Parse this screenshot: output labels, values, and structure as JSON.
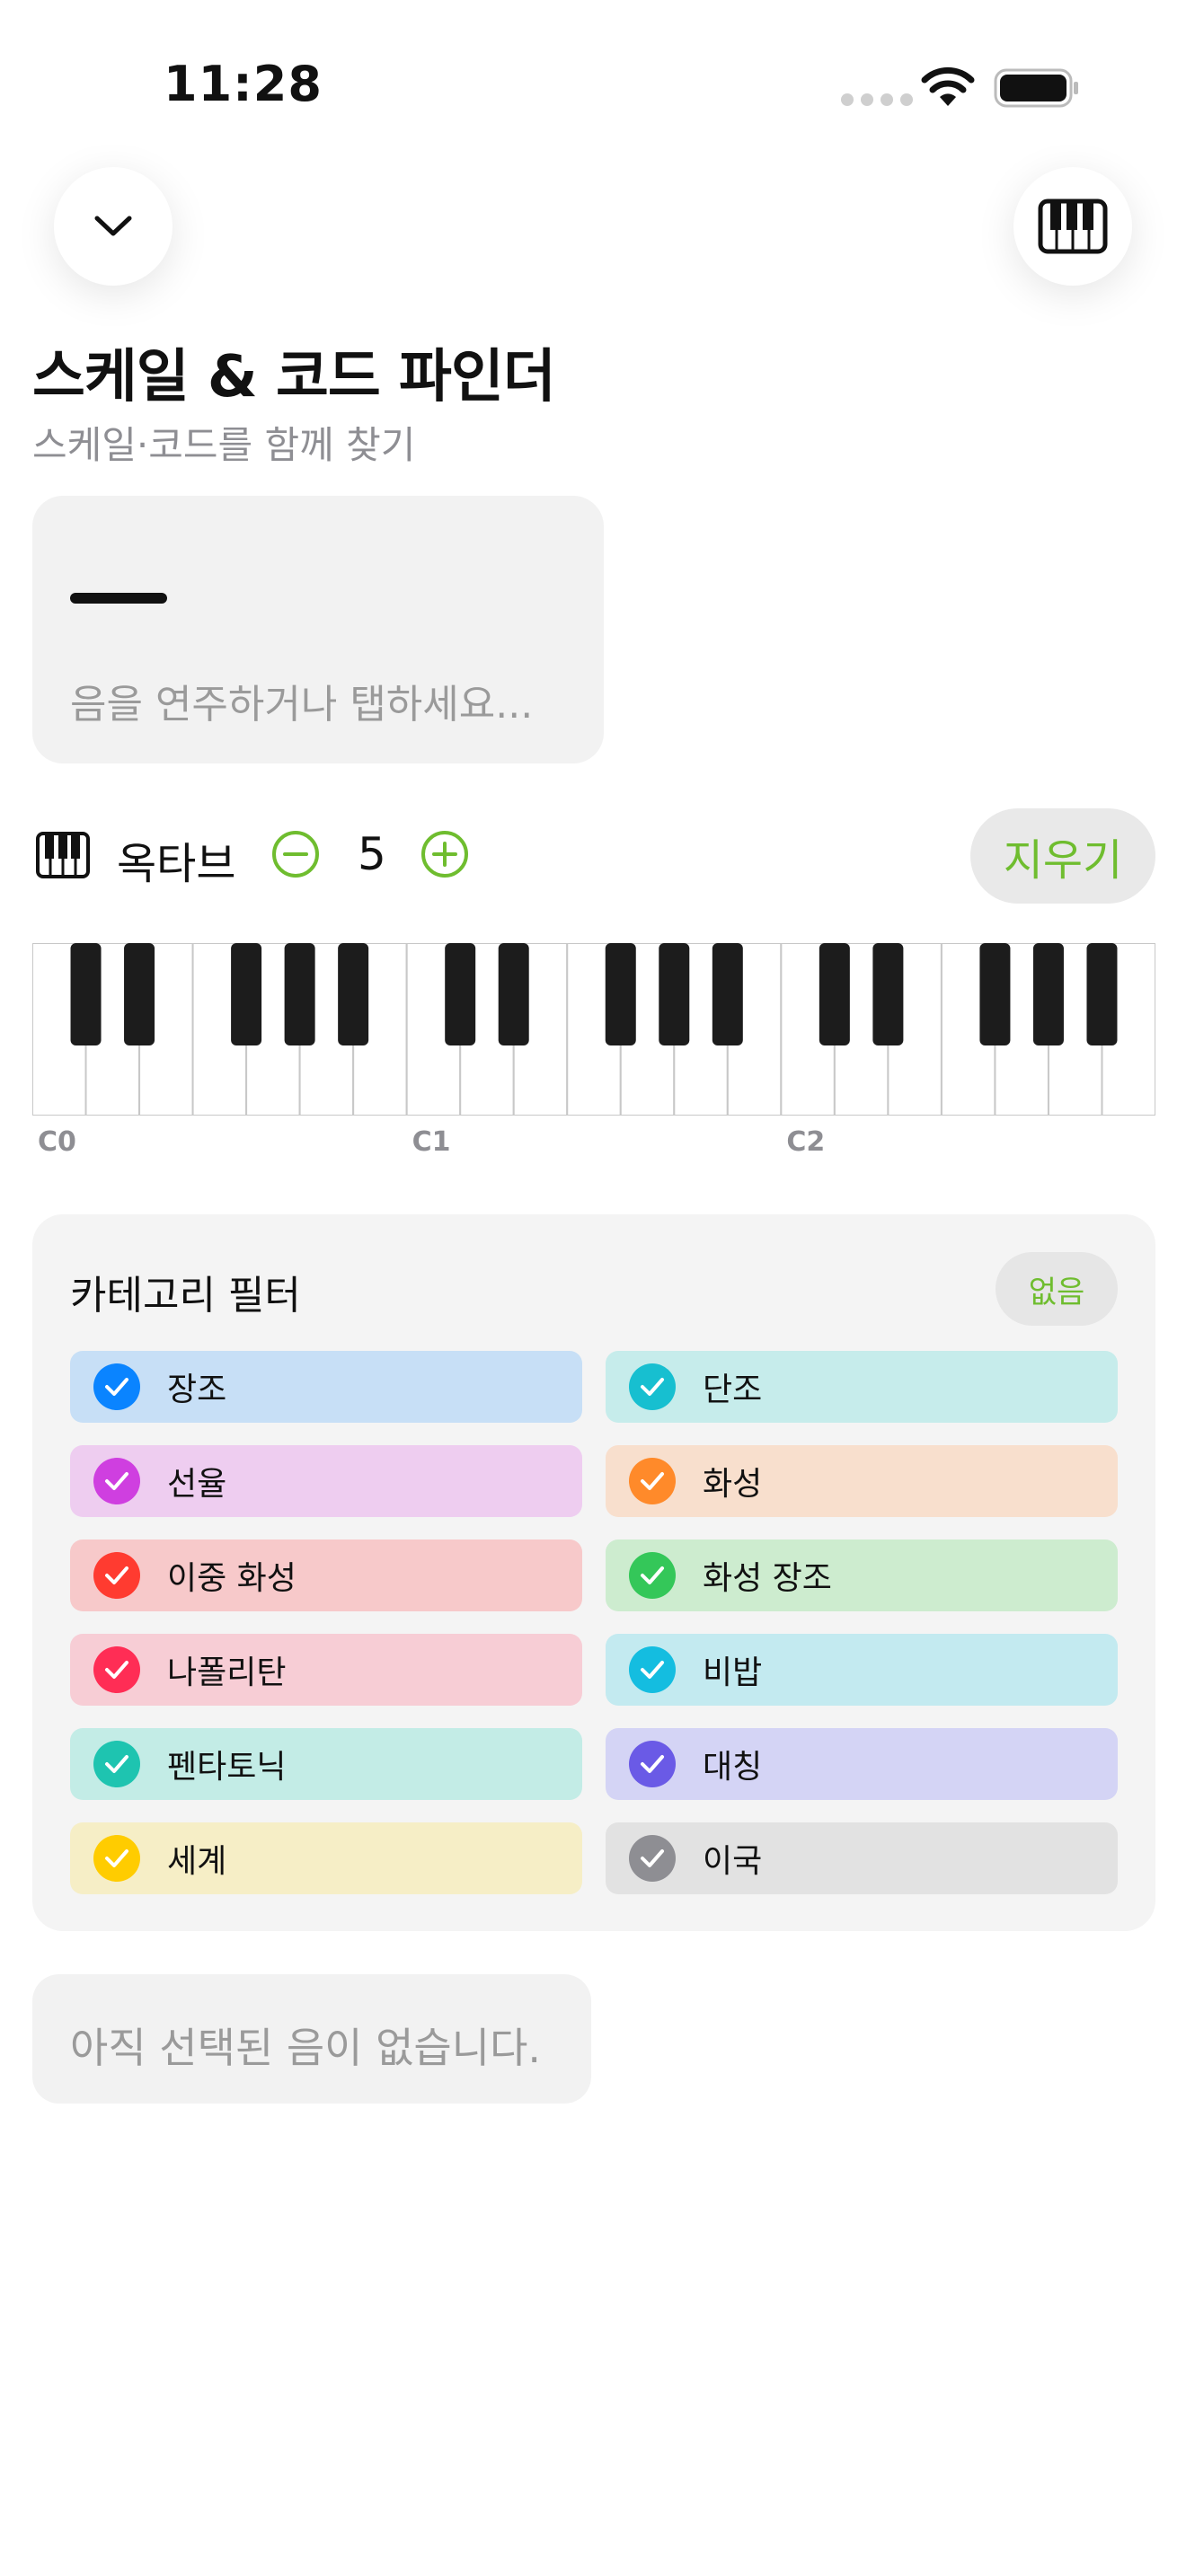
{
  "status": {
    "time": "11:28"
  },
  "header": {
    "title": "스케일 & 코드 파인더",
    "subtitle": "스케일·코드를 함께 찾기"
  },
  "note_input": {
    "value": "",
    "placeholder": "음을 연주하거나 탭하세요..."
  },
  "octave": {
    "label": "옥타브",
    "value": "5",
    "clear_label": "지우기"
  },
  "keyboard": {
    "labels": [
      "C0",
      "C1",
      "C2"
    ]
  },
  "filter": {
    "title": "카테고리 필터",
    "none_label": "없음",
    "categories": [
      {
        "label": "장조",
        "color": "#0a84ff",
        "bg": "#c7dff6"
      },
      {
        "label": "단조",
        "color": "#17bfd0",
        "bg": "#c6eceb"
      },
      {
        "label": "선율",
        "color": "#cf3fe0",
        "bg": "#eecdf0"
      },
      {
        "label": "화성",
        "color": "#ff8a2a",
        "bg": "#f8dfcd"
      },
      {
        "label": "이중 화성",
        "color": "#ff3b30",
        "bg": "#f7c9ca"
      },
      {
        "label": "화성 장조",
        "color": "#34c759",
        "bg": "#cdeccf"
      },
      {
        "label": "나폴리탄",
        "color": "#ff2d55",
        "bg": "#f7cdd5"
      },
      {
        "label": "비밥",
        "color": "#14bde0",
        "bg": "#c3eaf0"
      },
      {
        "label": "펜타토닉",
        "color": "#1ec4b0",
        "bg": "#c3ece6"
      },
      {
        "label": "대칭",
        "color": "#6a5ae6",
        "bg": "#d4d4f5"
      },
      {
        "label": "세계",
        "color": "#ffcc00",
        "bg": "#f6eec6"
      },
      {
        "label": "이국",
        "color": "#8e8e93",
        "bg": "#e2e2e2"
      }
    ]
  },
  "empty_state": {
    "message": "아직 선택된 음이 없습니다."
  },
  "colors": {
    "accent": "#6fbd2f"
  }
}
